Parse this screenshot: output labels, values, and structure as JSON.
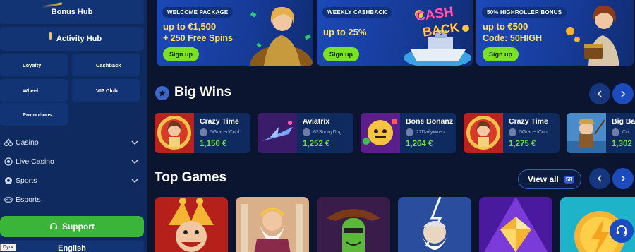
{
  "sidebar": {
    "bonus_hub": "Bonus Hub",
    "activity_hub": "Activity Hub",
    "grid": [
      "Loyalty",
      "Cashback",
      "Wheel",
      "VIP Club",
      "Promotions"
    ],
    "nav": [
      {
        "label": "Casino",
        "icon": "dice-icon"
      },
      {
        "label": "Live Casino",
        "icon": "live-icon"
      },
      {
        "label": "Sports",
        "icon": "ball-icon"
      },
      {
        "label": "Esports",
        "icon": "gamepad-icon"
      }
    ],
    "support_label": "Support",
    "language_label": "English",
    "tooltip": "Пуск"
  },
  "promos": [
    {
      "tag": "WELCOME PACKAGE",
      "line1": "up to €1,500",
      "line2": "+ 250 Free Spins",
      "button": "Sign up"
    },
    {
      "tag": "WEEKLY CASHBACK",
      "line1": "up to 25%",
      "line2": "",
      "button": "Sign up",
      "art_text_1": "CASH",
      "art_text_2": "BACK"
    },
    {
      "tag": "50% HIGHROLLER BONUS",
      "line1": "up to €500",
      "line2": "Code: 50HIGH",
      "button": "Sign up"
    }
  ],
  "big_wins": {
    "title": "Big Wins",
    "cards": [
      {
        "game": "Crazy Time",
        "user": "5GracedCool",
        "amount": "1,150 €"
      },
      {
        "game": "Aviatrix",
        "user": "62SunnyDug",
        "amount": "1,252 €"
      },
      {
        "game": "Bone Bonanz",
        "user": "27DailyWren",
        "amount": "1,264 €"
      },
      {
        "game": "Crazy Time",
        "user": "5GracedCool",
        "amount": "1,275 €"
      },
      {
        "game": "Big Ba",
        "user": "Cri",
        "amount": "1,302"
      }
    ]
  },
  "top_games": {
    "title": "Top Games",
    "view_all": "View all",
    "count": "58"
  },
  "colors": {
    "sidebar_bg": "#0e2a5e",
    "main_bg": "#0b1530",
    "accent_blue": "#1c4bbd",
    "signup_green": "#7be126",
    "support_green": "#3ab53a",
    "promo_yellow": "#ffe066",
    "win_green": "#6fe04a"
  }
}
